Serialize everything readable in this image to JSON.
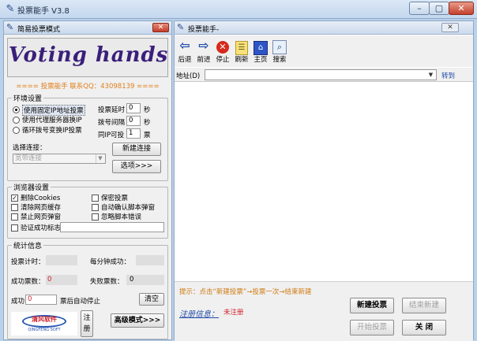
{
  "window": {
    "title": "投票能手 V3.8"
  },
  "left": {
    "header_title": "简易投票模式",
    "logo_text": "Voting hands",
    "contact": "==== 投票能手 联系QQ：43098139 ====",
    "env": {
      "title": "环境设置",
      "radios": [
        "使用固定IP地址投票",
        "使用代理服务器换IP",
        "循环拨号变换IP投票"
      ],
      "delay_label": "投票延时",
      "delay_value": "0",
      "delay_unit": "秒",
      "dial_label": "拨号间隔",
      "dial_value": "0",
      "dial_unit": "秒",
      "sameip_label": "同IP可投",
      "sameip_value": "1",
      "sameip_unit": "票",
      "conn_label": "选择连接：",
      "conn_value": "宽带连接",
      "new_conn_button": "新建连接",
      "options_button": "选项>>>"
    },
    "browser": {
      "title": "浏览器设置",
      "checks": [
        {
          "label": "删除Cookies",
          "checked": true
        },
        {
          "label": "保密投票",
          "checked": false
        },
        {
          "label": "清除网页缓存",
          "checked": false
        },
        {
          "label": "自动确认脚本弹窗",
          "checked": false
        },
        {
          "label": "禁止网页弹窗",
          "checked": false
        },
        {
          "label": "忽略脚本错误",
          "checked": false
        }
      ],
      "verify_label": "验证成功标志："
    },
    "stats": {
      "title": "统计信息",
      "time_label": "投票计时：",
      "perminute_label": "每分钟成功：",
      "success_label": "成功票数：",
      "success_value": "0",
      "fail_label": "失败票数：",
      "fail_value": "0",
      "auto_stop_prefix": "成功",
      "auto_stop_value": "0",
      "auto_stop_suffix": "票后自动停止",
      "clear_button": "清空",
      "brand_logo": "清风软件",
      "brand_sub": "QINGFENG SOFT",
      "register_button": "注册",
      "advanced_button": "高级模式>>>"
    }
  },
  "right": {
    "header_title": "投票能手-",
    "toolbar": [
      {
        "label": "后退",
        "icon": "back-arrow-icon"
      },
      {
        "label": "前进",
        "icon": "forward-arrow-icon"
      },
      {
        "label": "停止",
        "icon": "stop-icon"
      },
      {
        "label": "刷新",
        "icon": "refresh-icon"
      },
      {
        "label": "主页",
        "icon": "home-icon"
      },
      {
        "label": "搜索",
        "icon": "search-icon"
      }
    ],
    "address_label": "地址(D)",
    "goto_label": "转到",
    "hint": "提示：点击“新建投票”→投票一次→结束新建",
    "reg_info_label": "注册信息：",
    "reg_status": "未注册",
    "new_vote_button": "新建投票",
    "end_new_button": "结束新建",
    "start_vote_button": "开始投票",
    "close_button": "关 闭"
  }
}
